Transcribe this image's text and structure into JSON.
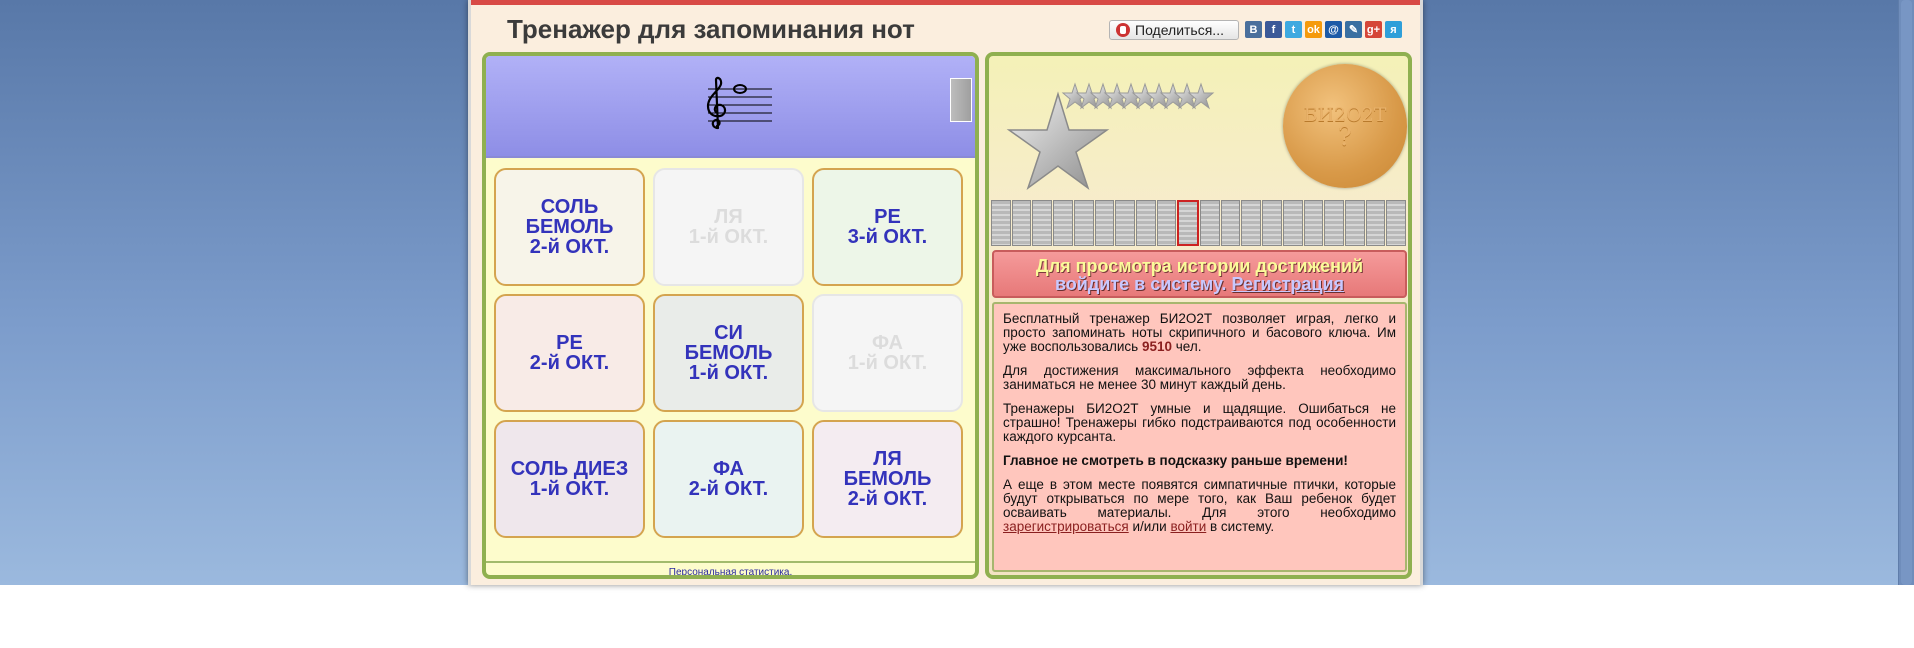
{
  "title": "Тренажер для запоминания нот",
  "share": {
    "label": "Поделиться..."
  },
  "social": [
    {
      "name": "vk-icon",
      "glyph": "B",
      "color": "#4a6f9c"
    },
    {
      "name": "facebook-icon",
      "glyph": "f",
      "color": "#3b5998"
    },
    {
      "name": "twitter-icon",
      "glyph": "t",
      "color": "#3ea9e0"
    },
    {
      "name": "odnoklassniki-icon",
      "glyph": "ok",
      "color": "#f59a0c"
    },
    {
      "name": "mailru-icon",
      "glyph": "@",
      "color": "#1d5aa7"
    },
    {
      "name": "livejournal-icon",
      "glyph": "✎",
      "color": "#3a6fa1"
    },
    {
      "name": "googleplus-icon",
      "glyph": "g+",
      "color": "#d54638"
    },
    {
      "name": "yaru-icon",
      "glyph": "я",
      "color": "#2f9fd9"
    }
  ],
  "cards": [
    {
      "label": "СОЛЬ\nБЕМОЛЬ\n2-й ОКТ.",
      "bg": "#f7f4e9",
      "faded": false
    },
    {
      "label": "ЛЯ\n1-й ОКТ.",
      "bg": "#f5f5f5",
      "faded": true
    },
    {
      "label": "РЕ\n3-й ОКТ.",
      "bg": "#edf6e8",
      "faded": false
    },
    {
      "label": "РЕ\n2-й ОКТ.",
      "bg": "#f8ebe7",
      "faded": false
    },
    {
      "label": "СИ\nБЕМОЛЬ\n1-й ОКТ.",
      "bg": "#e9ece9",
      "faded": false
    },
    {
      "label": "ФА\n1-й ОКТ.",
      "bg": "#f5f5f5",
      "faded": true
    },
    {
      "label": "СОЛЬ ДИЕЗ\n1-й ОКТ.",
      "bg": "#efe7ec",
      "faded": false
    },
    {
      "label": "ФА\n2-й ОКТ.",
      "bg": "#eaf3f1",
      "faded": false
    },
    {
      "label": "ЛЯ\nБЕМОЛЬ\n2-й ОКТ.",
      "bg": "#f4ecf1",
      "faded": false
    }
  ],
  "stats_link": "Персональная статистика.",
  "coin": {
    "title": "БИ2О2Т",
    "mark": "?"
  },
  "progress": {
    "count": 20,
    "current_index": 9
  },
  "login_box": {
    "line1": "Для просмотра истории достижений",
    "line2": "войдите в систему.",
    "register": "Регистрация"
  },
  "info": {
    "p1_text": "Бесплатный тренажер БИ2О2Т позволяет играя, легко и просто запоминать ноты скрипичного и басового ключа. Им уже воспользовались ",
    "p1_count": "9510",
    "p1_suffix": " чел.",
    "p2": "Для достижения максимального эффекта необходимо заниматься не менее 30 минут каждый день.",
    "p3": "Тренажеры БИ2О2Т умные и щадящие. Ошибаться не страшно! Тренажеры гибко подстраиваются под особенности каждого курсанта.",
    "p4": "Главное не смотреть в подсказку раньше времени!",
    "p5_text": "А еще в этом месте появятся симпатичные птички, которые будут открываться по мере того, как Ваш ребенок будет осваивать материалы. Для этого необходимо ",
    "p5_link1": "зарегистрироваться",
    "p5_mid": " и/или ",
    "p5_link2": "войти",
    "p5_suffix": " в систему."
  }
}
